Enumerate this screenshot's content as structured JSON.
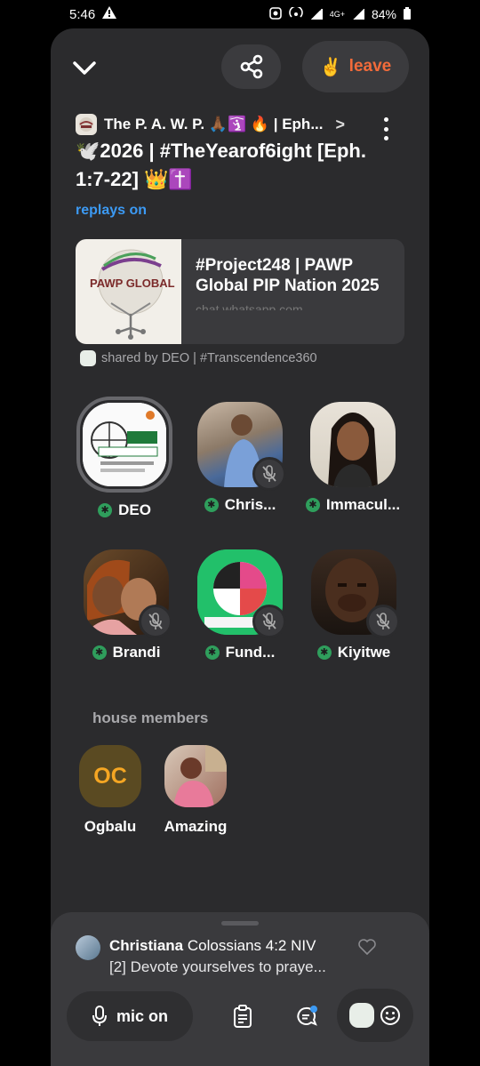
{
  "status": {
    "time": "5:46",
    "battery": "84%",
    "network": "4G+"
  },
  "topbar": {
    "leave_label": "leave",
    "leave_emoji": "✌️"
  },
  "club": {
    "name": "The P. A. W. P. 🙏🏾🛐 🔥 | Eph...",
    "arrow": ">"
  },
  "room": {
    "title": "🕊️2026 | #TheYearof6ight [Eph. 1:7-22] 👑✝️",
    "replays": "replays on"
  },
  "link": {
    "title": "#Project248 | PAWP Global PIP Nation 2025",
    "url": "chat.whatsapp.com",
    "thumb_text": "PAWP GLOBAL"
  },
  "shared_by": "shared by DEO | #Transcendence360",
  "speakers": [
    {
      "name": "DEO"
    },
    {
      "name": "Chris..."
    },
    {
      "name": "Immacul..."
    },
    {
      "name": "Brandi"
    },
    {
      "name": "Fund..."
    },
    {
      "name": "Kiyitwe"
    }
  ],
  "house_members_label": "house members",
  "members": [
    {
      "name": "Ogbalu",
      "initials": "OC"
    },
    {
      "name": "Amazing"
    }
  ],
  "chat": {
    "author": "Christiana",
    "ref": "Colossians 4:2 NIV",
    "message": "[2] Devote yourselves to praye..."
  },
  "toolbar": {
    "mic_label": "mic on"
  },
  "colors": {
    "panel": "#2b2b2d",
    "accent_blue": "#3c9af4",
    "leave": "#f26b3a",
    "speaker_badge": "#2f9e5c"
  }
}
